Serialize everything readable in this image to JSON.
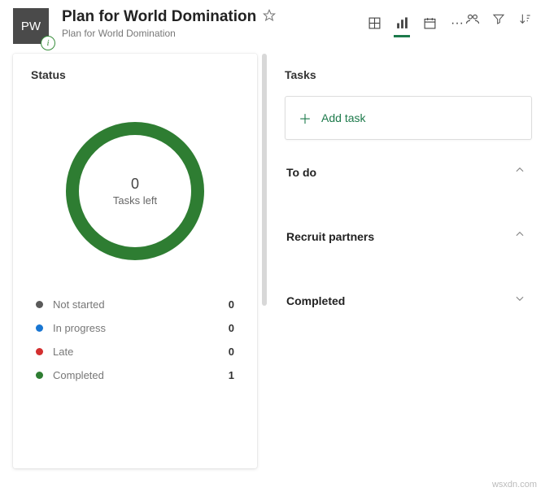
{
  "header": {
    "avatar_initials": "PW",
    "title": "Plan for World Domination",
    "subtitle": "Plan for World Domination",
    "info_badge": "i",
    "more": "···"
  },
  "chart_data": {
    "type": "pie",
    "title": "Status",
    "center_value": 0,
    "center_label": "Tasks left",
    "series": [
      {
        "name": "Not started",
        "value": 0,
        "color": "#5a5a5a"
      },
      {
        "name": "In progress",
        "value": 0,
        "color": "#1976d2"
      },
      {
        "name": "Late",
        "value": 0,
        "color": "#d32f2f"
      },
      {
        "name": "Completed",
        "value": 1,
        "color": "#2e7d32"
      }
    ]
  },
  "tasks": {
    "title": "Tasks",
    "add_label": "Add task",
    "buckets": [
      {
        "name": "To do",
        "collapsed": true
      },
      {
        "name": "Recruit partners",
        "collapsed": true
      },
      {
        "name": "Completed",
        "collapsed": false
      }
    ]
  },
  "watermark": "wsxdn.com"
}
